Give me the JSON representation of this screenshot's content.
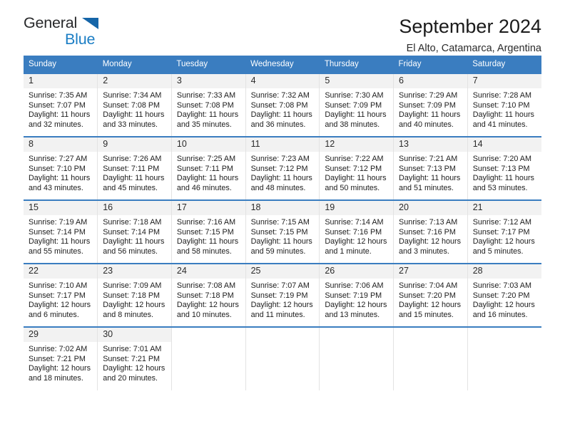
{
  "brand": {
    "name_top": "General",
    "name_bottom": "Blue",
    "triangle_icon": "triangle-icon",
    "accent_color": "#1a7dc4"
  },
  "header": {
    "title": "September 2024",
    "subtitle": "El Alto, Catamarca, Argentina"
  },
  "theme": {
    "header_bg": "#3a7dc0",
    "daynum_bg": "#f2f2f2",
    "grid_line": "#e3e3e3"
  },
  "weekday_headers": [
    "Sunday",
    "Monday",
    "Tuesday",
    "Wednesday",
    "Thursday",
    "Friday",
    "Saturday"
  ],
  "weeks": [
    [
      {
        "day": "1",
        "sunrise": "Sunrise: 7:35 AM",
        "sunset": "Sunset: 7:07 PM",
        "daylight": "Daylight: 11 hours and 32 minutes."
      },
      {
        "day": "2",
        "sunrise": "Sunrise: 7:34 AM",
        "sunset": "Sunset: 7:08 PM",
        "daylight": "Daylight: 11 hours and 33 minutes."
      },
      {
        "day": "3",
        "sunrise": "Sunrise: 7:33 AM",
        "sunset": "Sunset: 7:08 PM",
        "daylight": "Daylight: 11 hours and 35 minutes."
      },
      {
        "day": "4",
        "sunrise": "Sunrise: 7:32 AM",
        "sunset": "Sunset: 7:08 PM",
        "daylight": "Daylight: 11 hours and 36 minutes."
      },
      {
        "day": "5",
        "sunrise": "Sunrise: 7:30 AM",
        "sunset": "Sunset: 7:09 PM",
        "daylight": "Daylight: 11 hours and 38 minutes."
      },
      {
        "day": "6",
        "sunrise": "Sunrise: 7:29 AM",
        "sunset": "Sunset: 7:09 PM",
        "daylight": "Daylight: 11 hours and 40 minutes."
      },
      {
        "day": "7",
        "sunrise": "Sunrise: 7:28 AM",
        "sunset": "Sunset: 7:10 PM",
        "daylight": "Daylight: 11 hours and 41 minutes."
      }
    ],
    [
      {
        "day": "8",
        "sunrise": "Sunrise: 7:27 AM",
        "sunset": "Sunset: 7:10 PM",
        "daylight": "Daylight: 11 hours and 43 minutes."
      },
      {
        "day": "9",
        "sunrise": "Sunrise: 7:26 AM",
        "sunset": "Sunset: 7:11 PM",
        "daylight": "Daylight: 11 hours and 45 minutes."
      },
      {
        "day": "10",
        "sunrise": "Sunrise: 7:25 AM",
        "sunset": "Sunset: 7:11 PM",
        "daylight": "Daylight: 11 hours and 46 minutes."
      },
      {
        "day": "11",
        "sunrise": "Sunrise: 7:23 AM",
        "sunset": "Sunset: 7:12 PM",
        "daylight": "Daylight: 11 hours and 48 minutes."
      },
      {
        "day": "12",
        "sunrise": "Sunrise: 7:22 AM",
        "sunset": "Sunset: 7:12 PM",
        "daylight": "Daylight: 11 hours and 50 minutes."
      },
      {
        "day": "13",
        "sunrise": "Sunrise: 7:21 AM",
        "sunset": "Sunset: 7:13 PM",
        "daylight": "Daylight: 11 hours and 51 minutes."
      },
      {
        "day": "14",
        "sunrise": "Sunrise: 7:20 AM",
        "sunset": "Sunset: 7:13 PM",
        "daylight": "Daylight: 11 hours and 53 minutes."
      }
    ],
    [
      {
        "day": "15",
        "sunrise": "Sunrise: 7:19 AM",
        "sunset": "Sunset: 7:14 PM",
        "daylight": "Daylight: 11 hours and 55 minutes."
      },
      {
        "day": "16",
        "sunrise": "Sunrise: 7:18 AM",
        "sunset": "Sunset: 7:14 PM",
        "daylight": "Daylight: 11 hours and 56 minutes."
      },
      {
        "day": "17",
        "sunrise": "Sunrise: 7:16 AM",
        "sunset": "Sunset: 7:15 PM",
        "daylight": "Daylight: 11 hours and 58 minutes."
      },
      {
        "day": "18",
        "sunrise": "Sunrise: 7:15 AM",
        "sunset": "Sunset: 7:15 PM",
        "daylight": "Daylight: 11 hours and 59 minutes."
      },
      {
        "day": "19",
        "sunrise": "Sunrise: 7:14 AM",
        "sunset": "Sunset: 7:16 PM",
        "daylight": "Daylight: 12 hours and 1 minute."
      },
      {
        "day": "20",
        "sunrise": "Sunrise: 7:13 AM",
        "sunset": "Sunset: 7:16 PM",
        "daylight": "Daylight: 12 hours and 3 minutes."
      },
      {
        "day": "21",
        "sunrise": "Sunrise: 7:12 AM",
        "sunset": "Sunset: 7:17 PM",
        "daylight": "Daylight: 12 hours and 5 minutes."
      }
    ],
    [
      {
        "day": "22",
        "sunrise": "Sunrise: 7:10 AM",
        "sunset": "Sunset: 7:17 PM",
        "daylight": "Daylight: 12 hours and 6 minutes."
      },
      {
        "day": "23",
        "sunrise": "Sunrise: 7:09 AM",
        "sunset": "Sunset: 7:18 PM",
        "daylight": "Daylight: 12 hours and 8 minutes."
      },
      {
        "day": "24",
        "sunrise": "Sunrise: 7:08 AM",
        "sunset": "Sunset: 7:18 PM",
        "daylight": "Daylight: 12 hours and 10 minutes."
      },
      {
        "day": "25",
        "sunrise": "Sunrise: 7:07 AM",
        "sunset": "Sunset: 7:19 PM",
        "daylight": "Daylight: 12 hours and 11 minutes."
      },
      {
        "day": "26",
        "sunrise": "Sunrise: 7:06 AM",
        "sunset": "Sunset: 7:19 PM",
        "daylight": "Daylight: 12 hours and 13 minutes."
      },
      {
        "day": "27",
        "sunrise": "Sunrise: 7:04 AM",
        "sunset": "Sunset: 7:20 PM",
        "daylight": "Daylight: 12 hours and 15 minutes."
      },
      {
        "day": "28",
        "sunrise": "Sunrise: 7:03 AM",
        "sunset": "Sunset: 7:20 PM",
        "daylight": "Daylight: 12 hours and 16 minutes."
      }
    ],
    [
      {
        "day": "29",
        "sunrise": "Sunrise: 7:02 AM",
        "sunset": "Sunset: 7:21 PM",
        "daylight": "Daylight: 12 hours and 18 minutes."
      },
      {
        "day": "30",
        "sunrise": "Sunrise: 7:01 AM",
        "sunset": "Sunset: 7:21 PM",
        "daylight": "Daylight: 12 hours and 20 minutes."
      },
      null,
      null,
      null,
      null,
      null
    ]
  ]
}
